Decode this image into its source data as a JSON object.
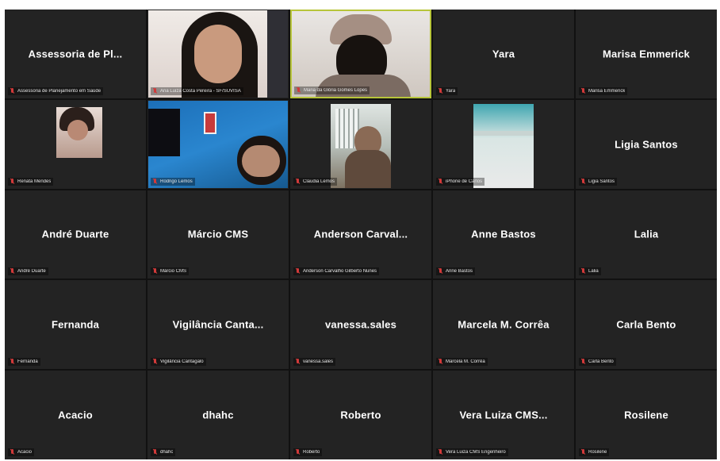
{
  "participants": [
    {
      "display": "Assessoria de Pl...",
      "label": "Assessoria de Planejamento em Saúde",
      "video": "none"
    },
    {
      "display": "",
      "label": "Ana Luiza Costa Pereira - SF/SUVISA",
      "video": "woman-dark-hair"
    },
    {
      "display": "",
      "label": "Maria da Glória Gomes Lopes",
      "video": "person-hat",
      "active": true
    },
    {
      "display": "Yara",
      "label": "Yara",
      "video": "none"
    },
    {
      "display": "Marisa Emmerick",
      "label": "Marisa Emmerick",
      "video": "none"
    },
    {
      "display": "",
      "label": "Renata Mendes",
      "video": "small-avatar"
    },
    {
      "display": "",
      "label": "Rodrigo Lemos",
      "video": "blue-office"
    },
    {
      "display": "",
      "label": "Claudia Lemos",
      "video": "window-person"
    },
    {
      "display": "",
      "label": "iPhone de Carlos",
      "video": "phone-ceiling"
    },
    {
      "display": "Ligia Santos",
      "label": "Ligia Santos",
      "video": "none"
    },
    {
      "display": "André Duarte",
      "label": "André Duarte",
      "video": "none"
    },
    {
      "display": "Márcio CMS",
      "label": "Márcio CMS",
      "video": "none"
    },
    {
      "display": "Anderson Carval...",
      "label": "Anderson Carvalho Gilberto Nunes",
      "video": "none"
    },
    {
      "display": "Anne Bastos",
      "label": "Anne Bastos",
      "video": "none"
    },
    {
      "display": "Lalia",
      "label": "Lalia",
      "video": "none"
    },
    {
      "display": "Fernanda",
      "label": "Fernanda",
      "video": "none"
    },
    {
      "display": "Vigilância Canta...",
      "label": "Vigilância Cantagalo",
      "video": "none"
    },
    {
      "display": "vanessa.sales",
      "label": "vanessa.sales",
      "video": "none"
    },
    {
      "display": "Marcela M. Corrêa",
      "label": "Marcela M. Corrêa",
      "video": "none"
    },
    {
      "display": "Carla Bento",
      "label": "Carla Bento",
      "video": "none"
    },
    {
      "display": "Acacio",
      "label": "Acacio",
      "video": "none"
    },
    {
      "display": "dhahc",
      "label": "dhahc",
      "video": "none"
    },
    {
      "display": "Roberto",
      "label": "Roberto",
      "video": "none"
    },
    {
      "display": "Vera Luiza CMS...",
      "label": "Vera Luiza CMS Engenheiro",
      "video": "none"
    },
    {
      "display": "Rosilene",
      "label": "Rosilene",
      "video": "none"
    }
  ],
  "icons": {
    "muted": "mic-muted-icon"
  },
  "colors": {
    "tile_bg": "#232323",
    "active_speaker_border": "#b7c53a",
    "muted_mic": "#d23a3a"
  }
}
